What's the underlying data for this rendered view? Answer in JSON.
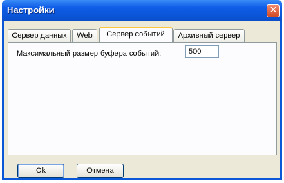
{
  "window": {
    "title": "Настройки",
    "close_glyph": "✕"
  },
  "tabs": [
    {
      "label": "Сервер данных",
      "active": false
    },
    {
      "label": "Web",
      "active": false
    },
    {
      "label": "Сервер событий",
      "active": true
    },
    {
      "label": "Архивный сервер",
      "active": false
    }
  ],
  "event_server": {
    "buffer_label": "Максимальный размер буфера событий:",
    "buffer_value": "500"
  },
  "buttons": {
    "ok_label": "Ok",
    "cancel_label": "Отмена"
  }
}
